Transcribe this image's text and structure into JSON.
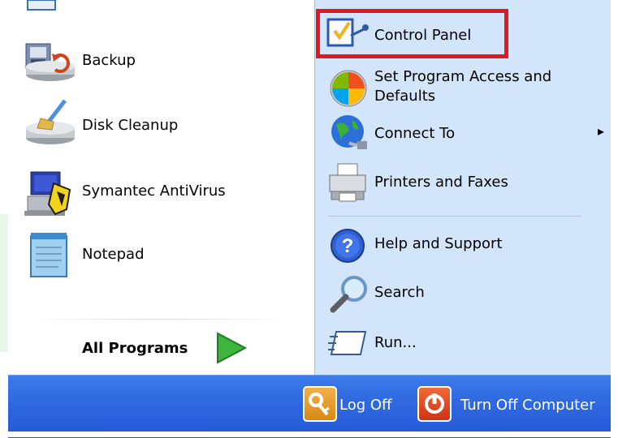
{
  "left_items": [
    {
      "label": "Backup",
      "icon": "backup-icon"
    },
    {
      "label": "Disk Cleanup",
      "icon": "disk-cleanup-icon"
    },
    {
      "label": "Symantec AntiVirus",
      "icon": "symantec-antivirus-icon"
    },
    {
      "label": "Notepad",
      "icon": "notepad-icon"
    }
  ],
  "all_programs": {
    "label": "All Programs",
    "icon": "green-arrow-icon"
  },
  "right_items": [
    {
      "label": "Control Panel",
      "icon": "control-panel-icon"
    },
    {
      "label": "Set Program Access and",
      "label2": "Defaults",
      "icon": "set-program-access-icon"
    },
    {
      "label": "Connect To",
      "icon": "connect-to-icon",
      "submenu_glyph": "▸"
    },
    {
      "label": "Printers and Faxes",
      "icon": "printers-icon"
    },
    {
      "label": "Help and Support",
      "icon": "help-icon",
      "icon_glyph": "?"
    },
    {
      "label": "Search",
      "icon": "search-icon"
    },
    {
      "label": "Run...",
      "icon": "run-icon"
    }
  ],
  "footer": {
    "log_off": "Log Off",
    "turn_off": "Turn Off Computer"
  },
  "colors": {
    "highlight": "#e4161f",
    "right_pane": "#d3e5fa",
    "taskbar_blue": "#2f6ae0"
  }
}
